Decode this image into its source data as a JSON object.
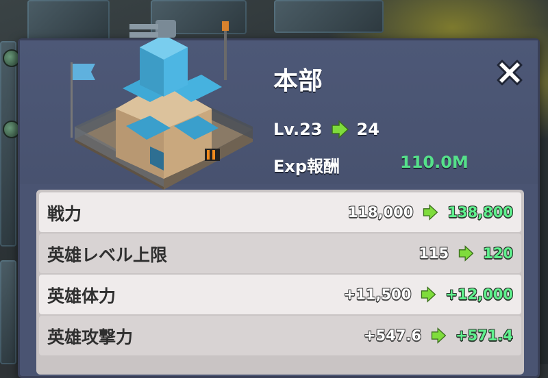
{
  "panel": {
    "title": "本部",
    "level": {
      "prefix": "Lv.",
      "current": "23",
      "next": "24"
    },
    "exp": {
      "label": "Exp報酬",
      "value": "110.0M"
    },
    "building_icon": "headquarters-building",
    "close_icon": "close-x"
  },
  "stats": [
    {
      "label": "戦力",
      "old": "118,000",
      "new": "138,800"
    },
    {
      "label": "英雄レベル上限",
      "old": "115",
      "new": "120"
    },
    {
      "label": "英雄体力",
      "old": "+11,500",
      "new": "+12,000"
    },
    {
      "label": "英雄攻撃力",
      "old": "+547.6",
      "new": "+571.4"
    }
  ],
  "colors": {
    "panel": "#4a5472",
    "accent_green": "#55e08a",
    "row_light": "#efebeb",
    "row_dark": "#d8d3d3"
  }
}
